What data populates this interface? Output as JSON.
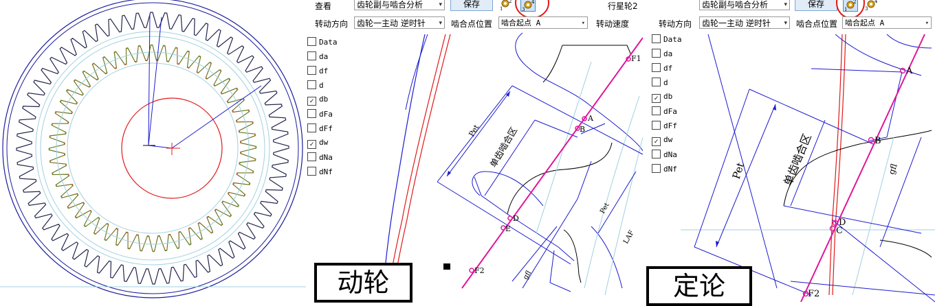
{
  "toolbar_a": {
    "view_label": "查看",
    "view_value": "齿轮副与啮合分析",
    "save_label": "保存",
    "planet_label": "行星轮2",
    "rotation_label": "转动方向",
    "rotation_value": "齿轮一主动 逆时针",
    "mesh_pos_label": "啮合点位置",
    "mesh_pos_value": "啮合起点 A",
    "speed_label": "转动速度"
  },
  "toolbar_b": {
    "view_value": "齿轮副与啮合分析",
    "save_label": "保存",
    "rotation_label": "转动方向",
    "rotation_value": "齿轮一主动 逆时针",
    "mesh_pos_label": "啮合点位置",
    "mesh_pos_value": "啮合起点 A"
  },
  "icons": {
    "gear_a": "2",
    "gear_b": "4",
    "gear_c": "1",
    "gear_d": "3"
  },
  "checkboxes": [
    {
      "label": "Data",
      "checked": false
    },
    {
      "label": "da",
      "checked": false
    },
    {
      "label": "df",
      "checked": false
    },
    {
      "label": "d",
      "checked": false
    },
    {
      "label": "db",
      "checked": true
    },
    {
      "label": "dFa",
      "checked": false
    },
    {
      "label": "dFf",
      "checked": false
    },
    {
      "label": "dw",
      "checked": true
    },
    {
      "label": "dNa",
      "checked": false
    },
    {
      "label": "dNf",
      "checked": false
    }
  ],
  "diagram_a": {
    "points": [
      "F1",
      "A",
      "B",
      "D",
      "E",
      "F2"
    ],
    "pet": "Pet",
    "single_zone": "单齿啮合区",
    "pet2": "Pet",
    "laf": "LAF",
    "gfl": "gfl"
  },
  "diagram_b": {
    "points": [
      "A",
      "B",
      "D",
      "C",
      "F2"
    ],
    "pet": "Pet",
    "single_zone": "单齿啮合区",
    "gfl": "gfl"
  },
  "captions": {
    "left": "动轮",
    "right": "定论"
  },
  "colors": {
    "blue": "#1a1ad0",
    "red": "#e01818",
    "magenta": "#e0149a",
    "lightblue": "#9fd0e0"
  }
}
